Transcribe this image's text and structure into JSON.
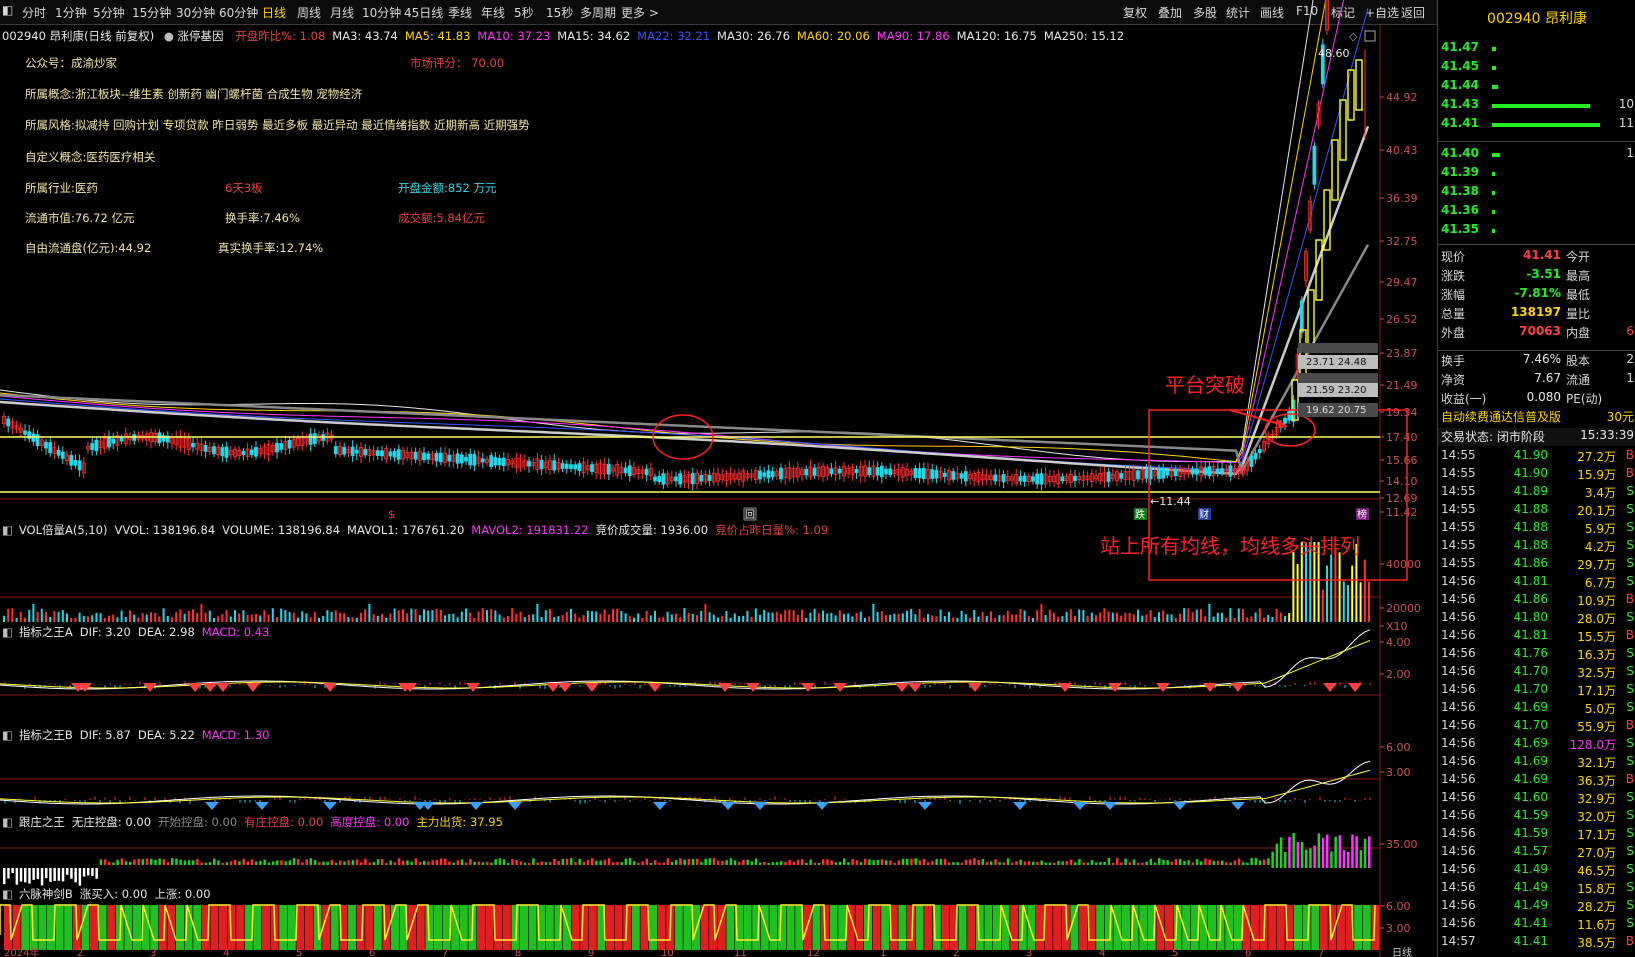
{
  "toolbar": {
    "left_items": [
      "分时",
      "1分钟",
      "5分钟",
      "15分钟",
      "30分钟",
      "60分钟",
      "日线",
      "周线",
      "月线",
      "10分钟",
      "45日线",
      "季线",
      "年线",
      "5秒",
      "15秒",
      "多周期",
      "更多"
    ],
    "active": "日线",
    "right_items": [
      "复权",
      "叠加",
      "多股",
      "统计",
      "画线",
      "F10",
      "标记",
      "+自选",
      "返回"
    ]
  },
  "stock": {
    "code": "002940",
    "name": "昂利康",
    "title_line": "002940 昂利康(日线 前复权)",
    "gene": "涨停基因"
  },
  "ma_line": [
    {
      "label": "开盘昨比%:",
      "value": "1.08",
      "color": "#e8413a"
    },
    {
      "label": "MA3:",
      "value": "43.74",
      "color": "#e8e8e8"
    },
    {
      "label": "MA5:",
      "value": "41.83",
      "color": "#ffd400"
    },
    {
      "label": "MA10:",
      "value": "37.23",
      "color": "#ff33ff"
    },
    {
      "label": "MA15:",
      "value": "34.62",
      "color": "#e8e8e8"
    },
    {
      "label": "MA22:",
      "value": "32.21",
      "color": "#3355ff"
    },
    {
      "label": "MA30:",
      "value": "26.76",
      "color": "#e8e8e8"
    },
    {
      "label": "MA60:",
      "value": "20.06",
      "color": "#ffd400"
    },
    {
      "label": "MA90:",
      "value": "17.86",
      "color": "#ff33ff"
    },
    {
      "label": "MA120:",
      "value": "16.75",
      "color": "#e8e8e8"
    },
    {
      "label": "MA250:",
      "value": "15.12",
      "color": "#e8e8e8"
    }
  ],
  "info": {
    "gzh": "公众号：成渝炒家",
    "score": "市场评分：  70.00",
    "concepts": "所属概念:浙江板块--维生素 创新药 幽门螺杆菌 合成生物 宠物经济",
    "styles": "所属风格:拟减持 回购计划 专项贷款 昨日弱势 最近多板 最近异动 最近情绪指数 近期新高 近期强势",
    "custom": "自定义概念:医药医疗相关",
    "industry": "所属行业:医药",
    "days": "6天3板",
    "open_amt": "开盘金额:852 万元",
    "float_cap": "流通市值:76.72 亿元",
    "turnover": "换手率:7.46%",
    "volume_amt": "成交额:5.84亿元",
    "free_float": "自由流通盘(亿元):44.92",
    "real_turnover": "真实换手率:12.74%"
  },
  "price_axis": [
    "44.92",
    "40.43",
    "36.39",
    "32.75",
    "29.47",
    "26.52",
    "23.87",
    "21.49",
    "19.34",
    "17.40",
    "15.66",
    "14.10",
    "12.69",
    "11.42"
  ],
  "high_label": "48.60",
  "low_label": "←11.44",
  "ma_boxes": [
    "23.71  24.48",
    "21.59  23.20",
    "19.62  20.75"
  ],
  "annotations": {
    "platform": "平台突破",
    "ma_bull": "站上所有均线，均线多头排列"
  },
  "markers": {
    "s": "$",
    "hui": "回",
    "die": "跌",
    "cai": "财",
    "bang": "榜"
  },
  "vol_header": [
    {
      "text": "VOL倍量A(5,10)",
      "color": "#e8e8e8"
    },
    {
      "text": "VVOL: 138196.84",
      "color": "#e8e8e8"
    },
    {
      "text": "VOLUME: 138196.84",
      "color": "#e8e8e8"
    },
    {
      "text": "MAVOL1: 176761.20",
      "color": "#e8e8e8"
    },
    {
      "text": "MAVOL2: 191831.22",
      "color": "#ff33ff"
    },
    {
      "text": "竞价成交量: 1936.00",
      "color": "#e8e8e8"
    },
    {
      "text": "竞价占昨日量%: 1.09",
      "color": "#e8413a"
    }
  ],
  "vol_axis": [
    "40000",
    "20000",
    "X10"
  ],
  "macd_a_header": [
    {
      "text": "指标之王A",
      "color": "#e8e8e8"
    },
    {
      "text": "DIF: 3.20",
      "color": "#e8e8e8"
    },
    {
      "text": "DEA: 2.98",
      "color": "#e8e8e8"
    },
    {
      "text": "MACD: 0.43",
      "color": "#ff33ff"
    }
  ],
  "macd_a_axis": [
    "4.00",
    "2.00"
  ],
  "macd_b_header": [
    {
      "text": "指标之王B",
      "color": "#e8e8e8"
    },
    {
      "text": "DIF: 5.87",
      "color": "#e8e8e8"
    },
    {
      "text": "DEA: 5.22",
      "color": "#e8e8e8"
    },
    {
      "text": "MACD: 1.30",
      "color": "#ff33ff"
    }
  ],
  "macd_b_axis": [
    "6.00",
    "3.00"
  ],
  "gz_header": [
    {
      "text": "跟庄之王",
      "color": "#e8e8e8"
    },
    {
      "text": "无庄控盘: 0.00",
      "color": "#e8e8e8"
    },
    {
      "text": "开始控盘: 0.00",
      "color": "#8a8a8a"
    },
    {
      "text": "有庄控盘: 0.00",
      "color": "#e8413a"
    },
    {
      "text": "高度控盘: 0.00",
      "color": "#ff33ff"
    },
    {
      "text": "主力出货: 37.95",
      "color": "#ffd400"
    }
  ],
  "gz_axis": [
    "35.00"
  ],
  "lm_header": [
    {
      "text": "六脉神剑B",
      "color": "#e8e8e8"
    },
    {
      "text": "涨买入: 0.00",
      "color": "#e8e8e8"
    },
    {
      "text": "上涨: 0.00",
      "color": "#e8e8e8"
    }
  ],
  "lm_axis": [
    "6.00",
    "3.00"
  ],
  "right_panel": {
    "title": "002940 昂利康",
    "asks": [
      {
        "price": "41.47",
        "vol": ""
      },
      {
        "price": "41.45",
        "vol": ""
      },
      {
        "price": "41.44",
        "vol": ""
      },
      {
        "price": "41.43",
        "vol": "10"
      },
      {
        "price": "41.41",
        "vol": "11"
      }
    ],
    "bids": [
      {
        "price": "41.40",
        "vol": "1"
      },
      {
        "price": "41.39",
        "vol": ""
      },
      {
        "price": "41.38",
        "vol": ""
      },
      {
        "price": "41.36",
        "vol": ""
      },
      {
        "price": "41.35",
        "vol": ""
      }
    ],
    "quote": [
      {
        "l1": "现价",
        "v1": "41.41",
        "l2": "今开",
        "v1c": "#ff4040"
      },
      {
        "l1": "涨跌",
        "v1": "-3.51",
        "l2": "最高",
        "v1c": "#22ee22"
      },
      {
        "l1": "涨幅",
        "v1": "-7.81%",
        "l2": "最低",
        "v1c": "#22ee22"
      },
      {
        "l1": "总量",
        "v1": "138197",
        "l2": "量比",
        "v1c": "#ffd400"
      },
      {
        "l1": "外盘",
        "v1": "70063",
        "l2": "内盘",
        "v1c": "#ff4040",
        "v2": "6"
      }
    ],
    "quote2": [
      {
        "l1": "换手",
        "v1": "7.46%",
        "l2": "股本",
        "v2": "2"
      },
      {
        "l1": "净资",
        "v1": "7.67",
        "l2": "流通",
        "v2": "1"
      },
      {
        "l1": "收益(一)",
        "v1": "0.080",
        "l2": "PE(动)",
        "v2": ""
      }
    ],
    "ad_text": "自动续费通达信普及版",
    "ad_price": "30元",
    "trade_status": "交易状态: 闭市阶段",
    "trade_time": "15:33:39",
    "ticks": [
      [
        "14:55",
        "41.90",
        "27.2万",
        "B"
      ],
      [
        "14:55",
        "41.90",
        "15.9万",
        "B"
      ],
      [
        "14:55",
        "41.89",
        "3.4万",
        "S"
      ],
      [
        "14:55",
        "41.88",
        "20.1万",
        "S"
      ],
      [
        "14:55",
        "41.88",
        "5.9万",
        "S"
      ],
      [
        "14:55",
        "41.88",
        "4.2万",
        "S"
      ],
      [
        "14:55",
        "41.86",
        "29.7万",
        "S"
      ],
      [
        "14:56",
        "41.81",
        "6.7万",
        "S"
      ],
      [
        "14:56",
        "41.86",
        "10.9万",
        "B"
      ],
      [
        "14:56",
        "41.80",
        "28.0万",
        "S"
      ],
      [
        "14:56",
        "41.81",
        "15.5万",
        "B"
      ],
      [
        "14:56",
        "41.76",
        "16.3万",
        "S"
      ],
      [
        "14:56",
        "41.70",
        "32.5万",
        "S"
      ],
      [
        "14:56",
        "41.70",
        "17.1万",
        "S"
      ],
      [
        "14:56",
        "41.69",
        "5.0万",
        "S"
      ],
      [
        "14:56",
        "41.70",
        "55.9万",
        "B"
      ],
      [
        "14:56",
        "41.69",
        "128.0万",
        "S"
      ],
      [
        "14:56",
        "41.69",
        "32.1万",
        "S"
      ],
      [
        "14:56",
        "41.69",
        "36.3万",
        "B"
      ],
      [
        "14:56",
        "41.60",
        "32.9万",
        "S"
      ],
      [
        "14:56",
        "41.59",
        "32.0万",
        "S"
      ],
      [
        "14:56",
        "41.59",
        "17.1万",
        "S"
      ],
      [
        "14:56",
        "41.57",
        "27.0万",
        "S"
      ],
      [
        "14:56",
        "41.49",
        "46.5万",
        "S"
      ],
      [
        "14:56",
        "41.49",
        "15.8万",
        "S"
      ],
      [
        "14:56",
        "41.49",
        "28.2万",
        "S"
      ],
      [
        "14:56",
        "41.41",
        "11.6万",
        "S"
      ],
      [
        "14:57",
        "41.41",
        "38.5万",
        "B"
      ]
    ]
  },
  "date_axis": [
    "2024年",
    "2",
    "3",
    "4",
    "5",
    "6",
    "7",
    "8",
    "9",
    "10",
    "11",
    "12",
    "1",
    "2",
    "3",
    "4",
    "5",
    "6",
    "7"
  ],
  "date_right": "日线"
}
